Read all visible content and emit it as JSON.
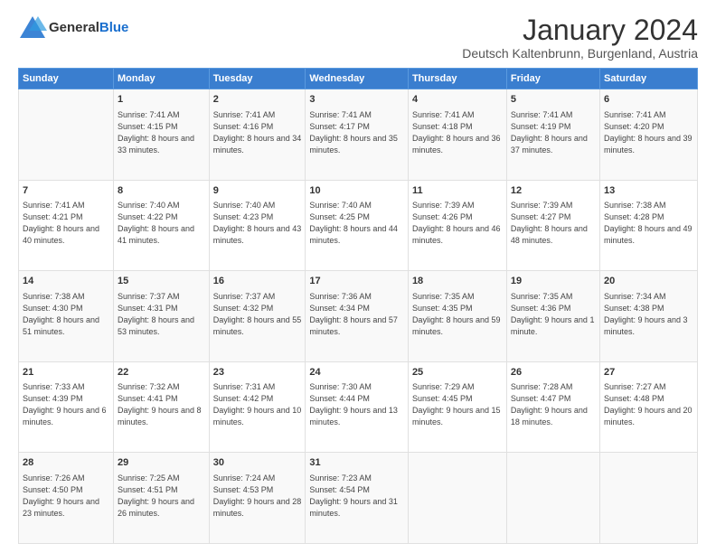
{
  "logo": {
    "general": "General",
    "blue": "Blue"
  },
  "title": "January 2024",
  "subtitle": "Deutsch Kaltenbrunn, Burgenland, Austria",
  "days": [
    "Sunday",
    "Monday",
    "Tuesday",
    "Wednesday",
    "Thursday",
    "Friday",
    "Saturday"
  ],
  "weeks": [
    [
      {
        "day": "",
        "sunrise": "",
        "sunset": "",
        "daylight": ""
      },
      {
        "day": "1",
        "sunrise": "Sunrise: 7:41 AM",
        "sunset": "Sunset: 4:15 PM",
        "daylight": "Daylight: 8 hours and 33 minutes."
      },
      {
        "day": "2",
        "sunrise": "Sunrise: 7:41 AM",
        "sunset": "Sunset: 4:16 PM",
        "daylight": "Daylight: 8 hours and 34 minutes."
      },
      {
        "day": "3",
        "sunrise": "Sunrise: 7:41 AM",
        "sunset": "Sunset: 4:17 PM",
        "daylight": "Daylight: 8 hours and 35 minutes."
      },
      {
        "day": "4",
        "sunrise": "Sunrise: 7:41 AM",
        "sunset": "Sunset: 4:18 PM",
        "daylight": "Daylight: 8 hours and 36 minutes."
      },
      {
        "day": "5",
        "sunrise": "Sunrise: 7:41 AM",
        "sunset": "Sunset: 4:19 PM",
        "daylight": "Daylight: 8 hours and 37 minutes."
      },
      {
        "day": "6",
        "sunrise": "Sunrise: 7:41 AM",
        "sunset": "Sunset: 4:20 PM",
        "daylight": "Daylight: 8 hours and 39 minutes."
      }
    ],
    [
      {
        "day": "7",
        "sunrise": "Sunrise: 7:41 AM",
        "sunset": "Sunset: 4:21 PM",
        "daylight": "Daylight: 8 hours and 40 minutes."
      },
      {
        "day": "8",
        "sunrise": "Sunrise: 7:40 AM",
        "sunset": "Sunset: 4:22 PM",
        "daylight": "Daylight: 8 hours and 41 minutes."
      },
      {
        "day": "9",
        "sunrise": "Sunrise: 7:40 AM",
        "sunset": "Sunset: 4:23 PM",
        "daylight": "Daylight: 8 hours and 43 minutes."
      },
      {
        "day": "10",
        "sunrise": "Sunrise: 7:40 AM",
        "sunset": "Sunset: 4:25 PM",
        "daylight": "Daylight: 8 hours and 44 minutes."
      },
      {
        "day": "11",
        "sunrise": "Sunrise: 7:39 AM",
        "sunset": "Sunset: 4:26 PM",
        "daylight": "Daylight: 8 hours and 46 minutes."
      },
      {
        "day": "12",
        "sunrise": "Sunrise: 7:39 AM",
        "sunset": "Sunset: 4:27 PM",
        "daylight": "Daylight: 8 hours and 48 minutes."
      },
      {
        "day": "13",
        "sunrise": "Sunrise: 7:38 AM",
        "sunset": "Sunset: 4:28 PM",
        "daylight": "Daylight: 8 hours and 49 minutes."
      }
    ],
    [
      {
        "day": "14",
        "sunrise": "Sunrise: 7:38 AM",
        "sunset": "Sunset: 4:30 PM",
        "daylight": "Daylight: 8 hours and 51 minutes."
      },
      {
        "day": "15",
        "sunrise": "Sunrise: 7:37 AM",
        "sunset": "Sunset: 4:31 PM",
        "daylight": "Daylight: 8 hours and 53 minutes."
      },
      {
        "day": "16",
        "sunrise": "Sunrise: 7:37 AM",
        "sunset": "Sunset: 4:32 PM",
        "daylight": "Daylight: 8 hours and 55 minutes."
      },
      {
        "day": "17",
        "sunrise": "Sunrise: 7:36 AM",
        "sunset": "Sunset: 4:34 PM",
        "daylight": "Daylight: 8 hours and 57 minutes."
      },
      {
        "day": "18",
        "sunrise": "Sunrise: 7:35 AM",
        "sunset": "Sunset: 4:35 PM",
        "daylight": "Daylight: 8 hours and 59 minutes."
      },
      {
        "day": "19",
        "sunrise": "Sunrise: 7:35 AM",
        "sunset": "Sunset: 4:36 PM",
        "daylight": "Daylight: 9 hours and 1 minute."
      },
      {
        "day": "20",
        "sunrise": "Sunrise: 7:34 AM",
        "sunset": "Sunset: 4:38 PM",
        "daylight": "Daylight: 9 hours and 3 minutes."
      }
    ],
    [
      {
        "day": "21",
        "sunrise": "Sunrise: 7:33 AM",
        "sunset": "Sunset: 4:39 PM",
        "daylight": "Daylight: 9 hours and 6 minutes."
      },
      {
        "day": "22",
        "sunrise": "Sunrise: 7:32 AM",
        "sunset": "Sunset: 4:41 PM",
        "daylight": "Daylight: 9 hours and 8 minutes."
      },
      {
        "day": "23",
        "sunrise": "Sunrise: 7:31 AM",
        "sunset": "Sunset: 4:42 PM",
        "daylight": "Daylight: 9 hours and 10 minutes."
      },
      {
        "day": "24",
        "sunrise": "Sunrise: 7:30 AM",
        "sunset": "Sunset: 4:44 PM",
        "daylight": "Daylight: 9 hours and 13 minutes."
      },
      {
        "day": "25",
        "sunrise": "Sunrise: 7:29 AM",
        "sunset": "Sunset: 4:45 PM",
        "daylight": "Daylight: 9 hours and 15 minutes."
      },
      {
        "day": "26",
        "sunrise": "Sunrise: 7:28 AM",
        "sunset": "Sunset: 4:47 PM",
        "daylight": "Daylight: 9 hours and 18 minutes."
      },
      {
        "day": "27",
        "sunrise": "Sunrise: 7:27 AM",
        "sunset": "Sunset: 4:48 PM",
        "daylight": "Daylight: 9 hours and 20 minutes."
      }
    ],
    [
      {
        "day": "28",
        "sunrise": "Sunrise: 7:26 AM",
        "sunset": "Sunset: 4:50 PM",
        "daylight": "Daylight: 9 hours and 23 minutes."
      },
      {
        "day": "29",
        "sunrise": "Sunrise: 7:25 AM",
        "sunset": "Sunset: 4:51 PM",
        "daylight": "Daylight: 9 hours and 26 minutes."
      },
      {
        "day": "30",
        "sunrise": "Sunrise: 7:24 AM",
        "sunset": "Sunset: 4:53 PM",
        "daylight": "Daylight: 9 hours and 28 minutes."
      },
      {
        "day": "31",
        "sunrise": "Sunrise: 7:23 AM",
        "sunset": "Sunset: 4:54 PM",
        "daylight": "Daylight: 9 hours and 31 minutes."
      },
      {
        "day": "",
        "sunrise": "",
        "sunset": "",
        "daylight": ""
      },
      {
        "day": "",
        "sunrise": "",
        "sunset": "",
        "daylight": ""
      },
      {
        "day": "",
        "sunrise": "",
        "sunset": "",
        "daylight": ""
      }
    ]
  ]
}
